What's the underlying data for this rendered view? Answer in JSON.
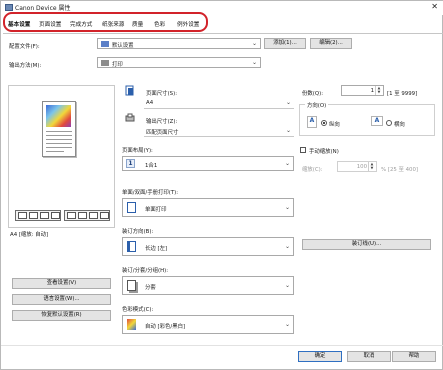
{
  "window": {
    "title": "Canon Device 属性",
    "close_glyph": "✕"
  },
  "tabs": [
    {
      "label": "基本设置",
      "active": true
    },
    {
      "label": "页面设置"
    },
    {
      "label": "完成方式"
    },
    {
      "label": "纸张来源"
    },
    {
      "label": "质量"
    },
    {
      "label": "色彩"
    },
    {
      "label": "例外设置"
    }
  ],
  "profile": {
    "label": "配置文件(F):",
    "value": "默认设置",
    "add_button": "添加(1)...",
    "edit_button": "编辑(2)..."
  },
  "output_method": {
    "label": "输出方法(M):",
    "value": "打印"
  },
  "page_size": {
    "label": "页面尺寸(S):",
    "value": "A4"
  },
  "output_size": {
    "label": "输出尺寸(Z):",
    "value": "匹配页面尺寸"
  },
  "copies": {
    "label": "份数(Q):",
    "value": "1",
    "range": "[1 至 9999]"
  },
  "orientation": {
    "label": "方向(O)",
    "portrait_label": "纵向",
    "landscape_label": "横向",
    "icon_letter": "A",
    "selected": "portrait"
  },
  "page_layout": {
    "label": "页面布局(Y):",
    "value": "1合1",
    "badge": "1"
  },
  "manual_scaling": {
    "label": "手动缩放(N)",
    "checked": false,
    "scale_label": "缩放(C):",
    "scale_value": "100",
    "scale_range": "% [25 至 400]"
  },
  "duplex": {
    "label": "单面/双面/手册打印(T):",
    "value": "单面打印"
  },
  "binding": {
    "label": "装订方向(B):",
    "value": "长边 [左]",
    "button": "装订线(U)..."
  },
  "finishing": {
    "label": "装订/分套/分组(H):",
    "value": "分套"
  },
  "color_mode": {
    "label": "色彩模式(C):",
    "value": "自动 [彩色/黑白]"
  },
  "preview": {
    "caption": "A4 [缩放: 自动]"
  },
  "left_buttons": {
    "view_settings": "查看设置(V)",
    "language_settings": "语言设置(W)...",
    "restore_defaults": "恢复默认设置(R)"
  },
  "footer": {
    "ok": "确定",
    "cancel": "取消",
    "help": "帮助"
  },
  "colors": {
    "highlight": "#d2232a",
    "accent": "#2f6fc1"
  },
  "icons": [
    "printer-icon",
    "document-icon",
    "radio-icon",
    "chevron-down-icon"
  ]
}
